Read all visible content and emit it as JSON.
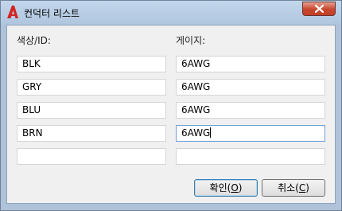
{
  "window": {
    "title": "컨덕터 리스트",
    "app_icon": "autocad-a-icon",
    "close_icon": "close-icon"
  },
  "columns": {
    "color_label": "색상/ID:",
    "gauge_label": "게이지:"
  },
  "rows": [
    {
      "color": "BLK",
      "gauge": "6AWG"
    },
    {
      "color": "GRY",
      "gauge": "6AWG"
    },
    {
      "color": "BLU",
      "gauge": "6AWG"
    },
    {
      "color": "BRN",
      "gauge": "6AWG"
    },
    {
      "color": "",
      "gauge": ""
    }
  ],
  "buttons": {
    "ok_text": "확인(",
    "ok_mnemonic": "O",
    "ok_suffix": ")",
    "cancel_text": "취소(",
    "cancel_mnemonic": "C",
    "cancel_suffix": ")"
  },
  "colors": {
    "titlebar": "#b0c6de",
    "close_button": "#c8452c",
    "app_icon": "#d32323"
  }
}
